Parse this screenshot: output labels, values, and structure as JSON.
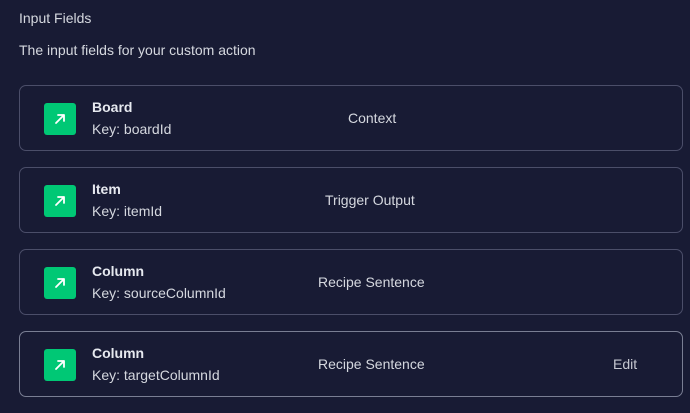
{
  "section": {
    "title": "Input Fields",
    "description": "The input fields for your custom action"
  },
  "fields": [
    {
      "icon": "arrow-up-right-icon",
      "name": "Board",
      "key": "Key: boardId",
      "source": "Context"
    },
    {
      "icon": "arrow-up-right-icon",
      "name": "Item",
      "key": "Key: itemId",
      "source": "Trigger Output"
    },
    {
      "icon": "arrow-up-right-icon",
      "name": "Column",
      "key": "Key: sourceColumnId",
      "source": "Recipe Sentence"
    },
    {
      "icon": "arrow-up-right-icon",
      "name": "Column",
      "key": "Key: targetColumnId",
      "source": "Recipe Sentence",
      "action": "Edit"
    }
  ],
  "colors": {
    "background": "#181b34",
    "icon_background": "#00c875",
    "card_border": "#4b4e69"
  }
}
